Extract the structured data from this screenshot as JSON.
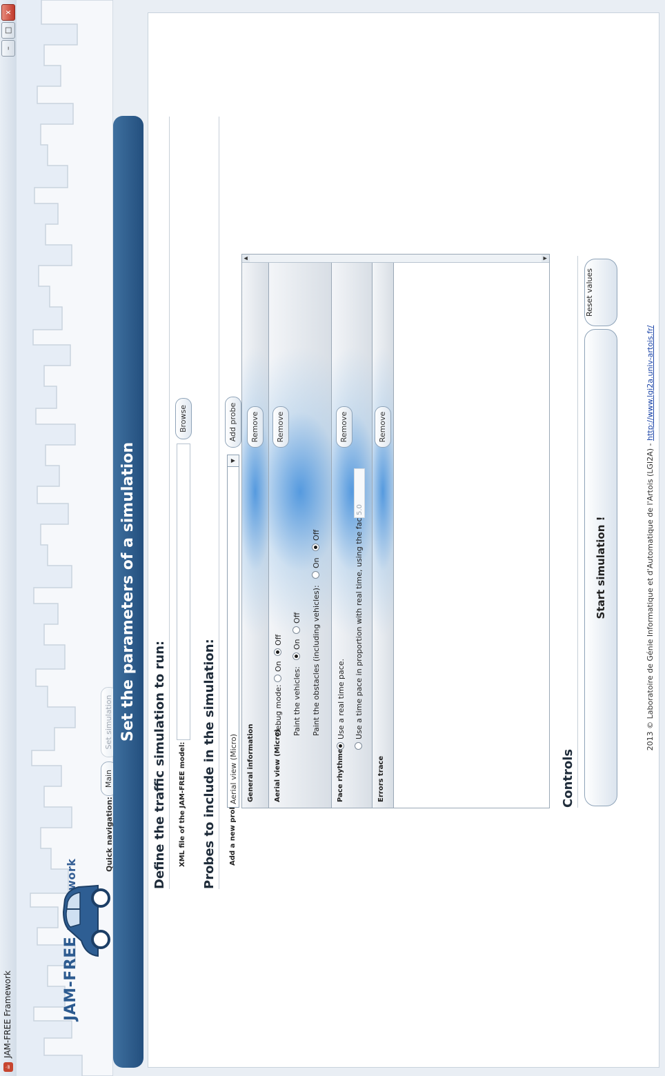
{
  "window": {
    "title": "JAM-FREE Framework",
    "minimize": "–",
    "maximize": "□",
    "close": "x"
  },
  "branding": {
    "logo_jam": "JAM-",
    "logo_free": "FREE",
    "logo_framework": "Framework",
    "accent_color": "#2d5b90",
    "header_color": "#2f5f8f"
  },
  "nav": {
    "label": "Quick navigation:",
    "main_label": "Main",
    "set_simulation_label": "Set simulation"
  },
  "header": {
    "title": "Set the parameters of a simulation"
  },
  "define": {
    "title": "Define the traffic simulation to run:",
    "xml_label": "XML file of the JAM-FREE model:",
    "xml_value": "",
    "browse_label": "Browse"
  },
  "probes": {
    "title": "Probes to include in the simulation:",
    "add_label": "Add a new probe:",
    "selected": "Aerial view (Micro)",
    "add_button": "Add probe",
    "remove_label": "Remove",
    "items": [
      {
        "name": "General information"
      },
      {
        "name": "Aerial view (Micro)",
        "debug_label": "Debug mode:",
        "paint_vehicles_label": "Paint the vehicles:",
        "paint_obstacles_label": "Paint the obstacles (including vehicles):",
        "on": "On",
        "off": "Off"
      },
      {
        "name": "Pace rhythmer",
        "real_time": "Use a real time pace.",
        "proportional": "Use a time pace in proportion with real time, using the factor:",
        "factor": "5.0"
      },
      {
        "name": "Errors trace"
      }
    ]
  },
  "controls": {
    "title": "Controls",
    "start_label": "Start simulation !",
    "reset_label": "Reset values"
  },
  "footer": {
    "text": "2013 © Laboratoire de Génie Informatique et d'Automatique de l'Artois (LGI2A)  -  ",
    "link": "http://www.lgi2a.univ-artois.fr/"
  }
}
